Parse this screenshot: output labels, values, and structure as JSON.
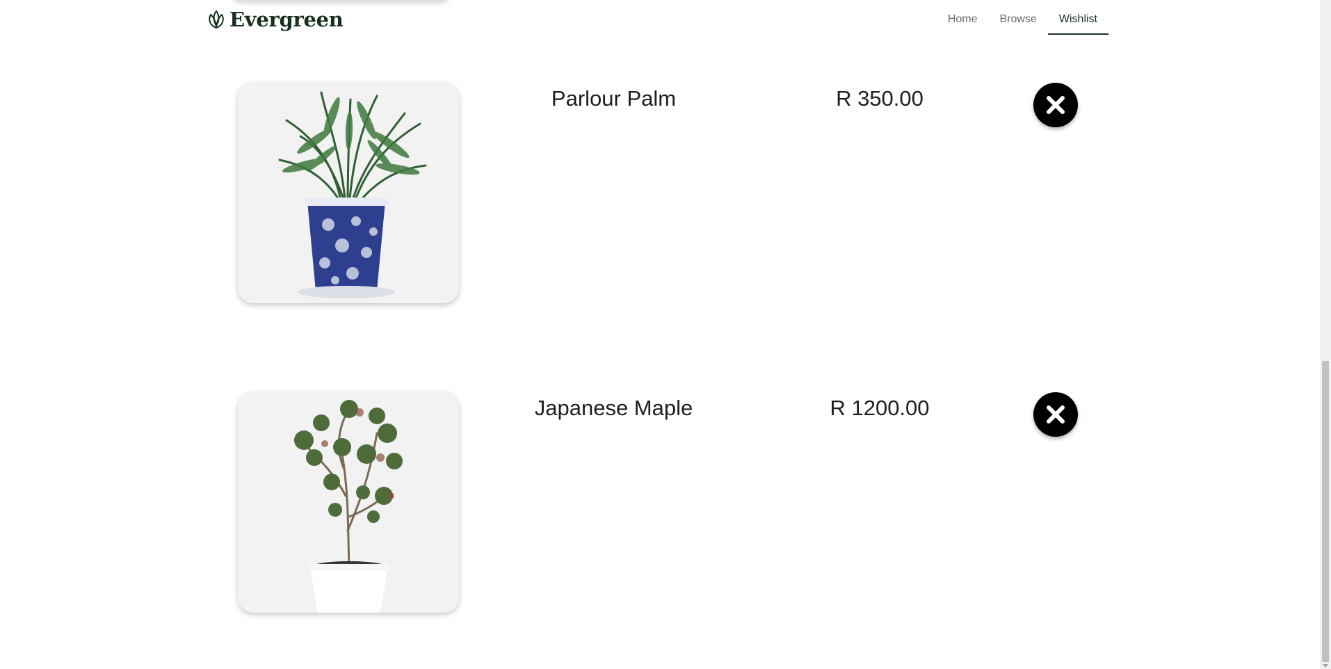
{
  "brand": {
    "name": "Evergreen",
    "icon": "leaf-icon"
  },
  "nav": [
    {
      "label": "Home",
      "active": false
    },
    {
      "label": "Browse",
      "active": false
    },
    {
      "label": "Wishlist",
      "active": true
    }
  ],
  "wishlist": [
    {
      "name": "Parlour Palm",
      "price": "R 350.00",
      "image": "parlour-palm-image"
    },
    {
      "name": "Japanese Maple",
      "price": "R 1200.00",
      "image": "japanese-maple-image"
    }
  ],
  "colors": {
    "brand": "#17301f",
    "remove_button": "#000000",
    "thumb_bg": "#f2f2f2"
  }
}
